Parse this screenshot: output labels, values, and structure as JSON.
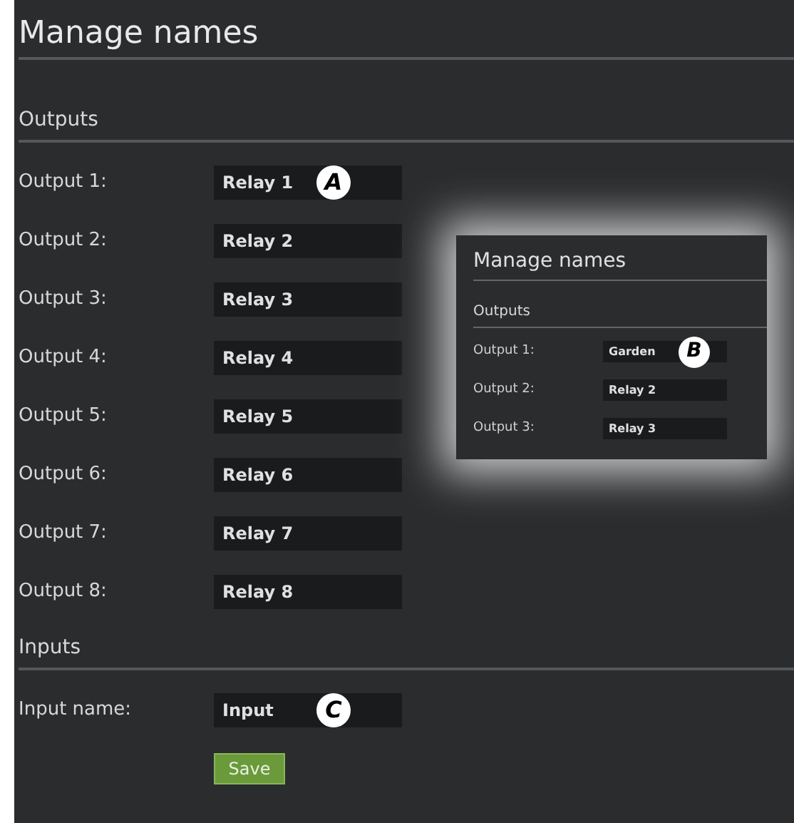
{
  "title": "Manage names",
  "outputs": {
    "heading": "Outputs",
    "rows": [
      {
        "label": "Output 1:",
        "value": "Relay 1",
        "callout": "A"
      },
      {
        "label": "Output 2:",
        "value": "Relay 2"
      },
      {
        "label": "Output 3:",
        "value": "Relay 3"
      },
      {
        "label": "Output 4:",
        "value": "Relay 4"
      },
      {
        "label": "Output 5:",
        "value": "Relay 5"
      },
      {
        "label": "Output 6:",
        "value": "Relay 6"
      },
      {
        "label": "Output 7:",
        "value": "Relay 7"
      },
      {
        "label": "Output 8:",
        "value": "Relay 8"
      }
    ]
  },
  "inputs": {
    "heading": "Inputs",
    "rows": [
      {
        "label": "Input name:",
        "value": "Input",
        "callout": "C"
      }
    ]
  },
  "save_button": "Save",
  "inset": {
    "title": "Manage names",
    "heading": "Outputs",
    "rows": [
      {
        "label": "Output 1:",
        "value": "Garden",
        "callout": "B"
      },
      {
        "label": "Output 2:",
        "value": "Relay 2"
      },
      {
        "label": "Output 3:",
        "value": "Relay 3"
      }
    ]
  }
}
